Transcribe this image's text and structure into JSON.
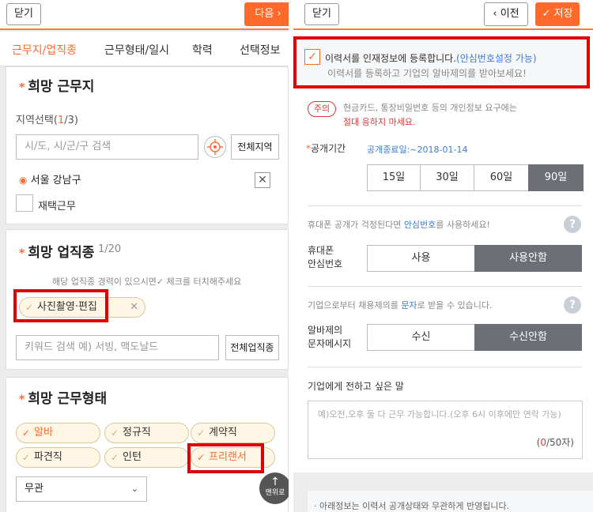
{
  "left": {
    "topbar": {
      "close_label": "닫기",
      "next_label": "다음 ›"
    },
    "tabs": [
      "근무지/업직종",
      "근무형태/일시",
      "학력",
      "선택정보"
    ],
    "location": {
      "title": "희망 근무지",
      "region_label": "지역선택(",
      "region_count": "1",
      "region_total": "/3)",
      "search_placeholder": "시/도, 시/군/구 검색",
      "all_regions_label": "전체지역",
      "selected_region": "서울 강남구",
      "remote_label": "재택근무"
    },
    "job": {
      "title": "희망 업직종",
      "count": "1/20",
      "hint": "해당 업직종 경력이 있으시면✓ 체크를 터치해주세요",
      "selected_job": "사진촬영·편집",
      "keyword_placeholder": "키워드 검색 예) 서빙, 맥도날드",
      "all_jobs_label": "전체업직종"
    },
    "work_type": {
      "title": "희망 근무형태",
      "options": [
        {
          "label": "알바",
          "on": true
        },
        {
          "label": "정규직",
          "on": false
        },
        {
          "label": "계약직",
          "on": false
        },
        {
          "label": "파견직",
          "on": false
        },
        {
          "label": "인턴",
          "on": false
        },
        {
          "label": "프리랜서",
          "on": true
        }
      ],
      "dropdown_value": "무관",
      "top_button_label": "맨위로"
    }
  },
  "right": {
    "topbar": {
      "close_label": "닫기",
      "prev_label": "‹ 이전",
      "save_label": "✓ 저장"
    },
    "register": {
      "label": "이력서를 인재정보에 등록합니다.",
      "link": "(안심번호설정 가능)",
      "sub": "이력서를 등록하고 기업의 알바제의를 받아보세요!"
    },
    "notice": {
      "badge": "주의",
      "line1": "현금카드, 통장비밀번호 등의 개인정보 요구에는",
      "line2": "절대 응하지 마세요."
    },
    "period": {
      "label": "공개기간",
      "end_date": "공개종료일:~2018-01-14",
      "options": [
        "15일",
        "30일",
        "60일",
        "90일"
      ],
      "selected": "90일"
    },
    "phone": {
      "hint_pre": "휴대폰 공개가 걱정된다면 ",
      "hint_link": "안심번호",
      "hint_post": "를 사용하세요!",
      "label_line1": "휴대폰",
      "label_line2": "안심번호",
      "options": [
        "사용",
        "사용안함"
      ],
      "selected": "사용안함"
    },
    "sms": {
      "hint_pre": "기업으로부터 채용제의를 ",
      "hint_link": "문자",
      "hint_post": "로 받을 수 있습니다.",
      "label_line1": "알바제의",
      "label_line2": "문자메시지",
      "options": [
        "수신",
        "수신안함"
      ],
      "selected": "수신안함"
    },
    "message": {
      "title": "기업에게 전하고 싶은 말",
      "placeholder": "예)오전,오후 둘 다 근무 가능합니다.(오후 6시 이후에만 연락 가능)",
      "counter_open": "(",
      "counter_value": "0",
      "counter_close": "/50자)"
    },
    "footer_note": "· 아래정보는 이력서 공개상태와 무관하게 반영됩니다."
  },
  "colors": {
    "accent": "#ff6a2b",
    "highlight_box": "#e00000",
    "selected_segment": "#6c6f75"
  }
}
